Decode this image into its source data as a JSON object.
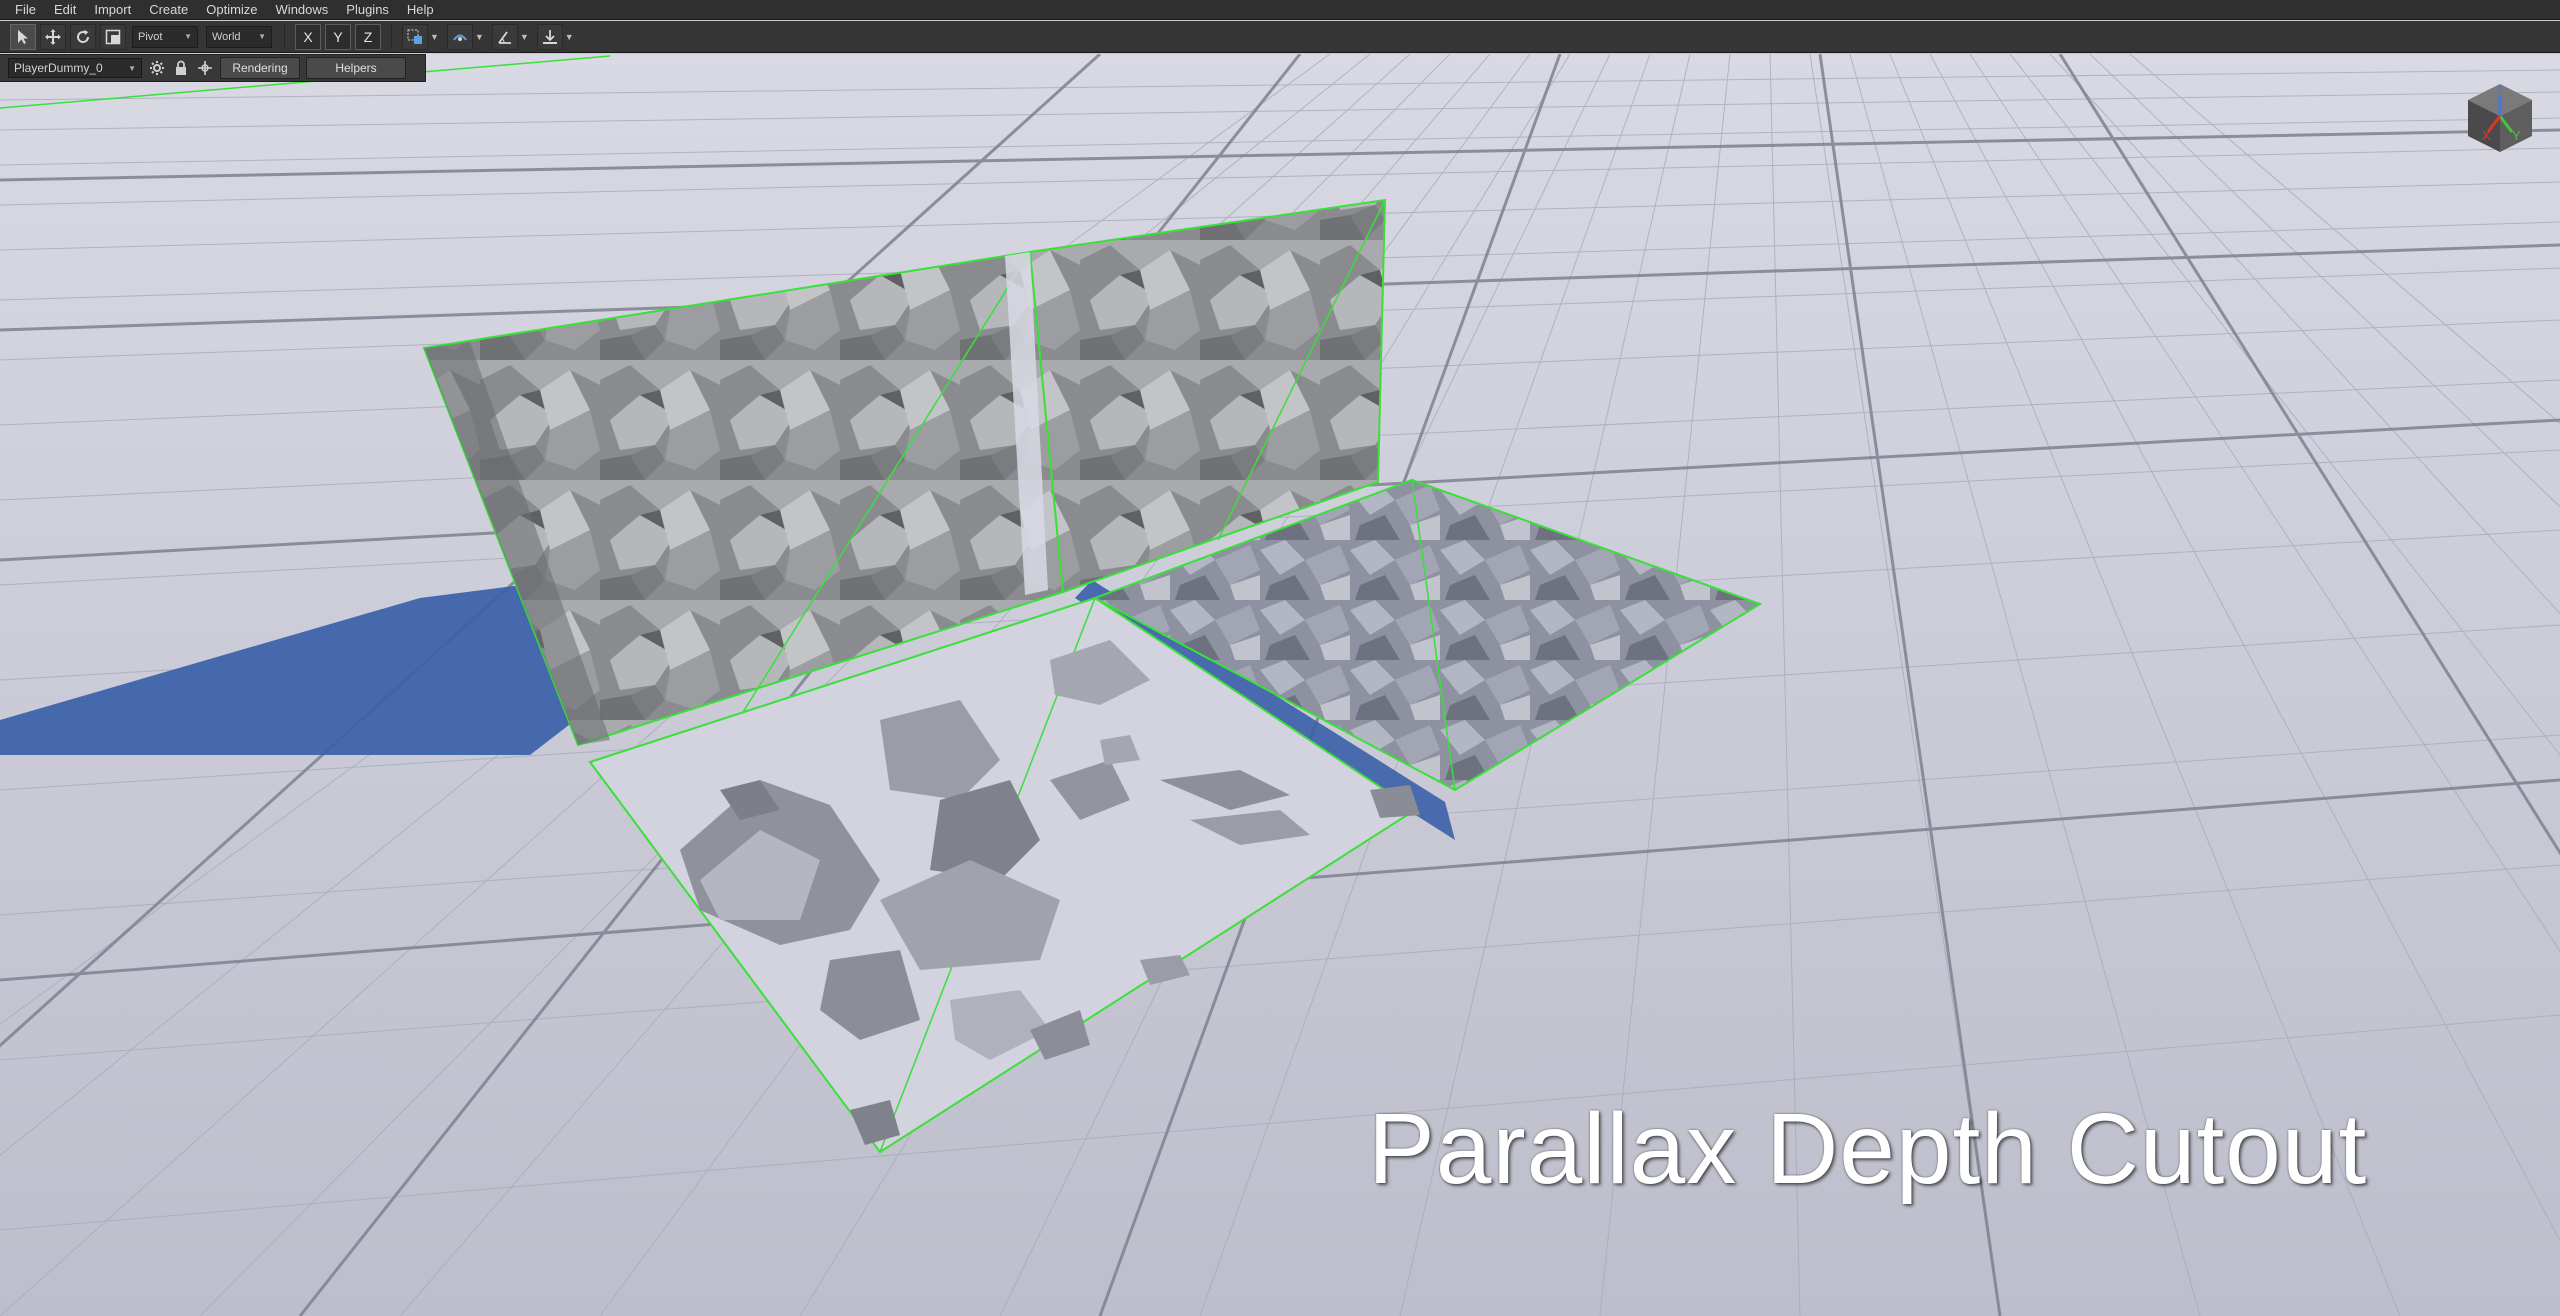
{
  "menu": [
    "File",
    "Edit",
    "Import",
    "Create",
    "Optimize",
    "Windows",
    "Plugins",
    "Help"
  ],
  "toolbar": {
    "reference_select": "Pivot",
    "space_select": "World",
    "axis_x": "X",
    "axis_y": "Y",
    "axis_z": "Z"
  },
  "viewport": {
    "object_select": "PlayerDummy_0",
    "rendering_button": "Rendering",
    "helpers_button": "Helpers",
    "overlay_title": "Parallax Depth Cutout"
  },
  "gizmo": {
    "x_label": "X",
    "y_label": "Y",
    "z_label": "Z"
  },
  "colors": {
    "selection_outline": "#39e03a",
    "shadow": "#3b5fa8",
    "grid_floor": "#c9cad6",
    "axis_x": "#e0332a",
    "axis_y": "#49c23f",
    "axis_z": "#4a74e0"
  }
}
